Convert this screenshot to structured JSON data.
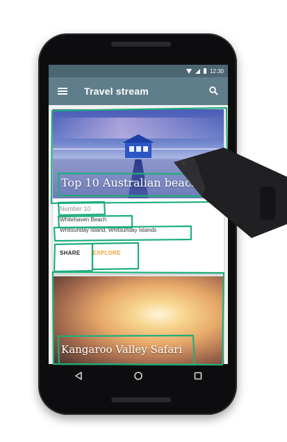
{
  "status_bar": {
    "time": "12:30"
  },
  "app_bar": {
    "title": "Travel stream",
    "menu_icon": "menu-icon",
    "search_icon": "search-icon"
  },
  "cards": [
    {
      "title": "Top 10 Australian beaches",
      "subtitle": "Number 10",
      "line1": "Whitehaven Beach",
      "line2": "Whitsunday Island, Whitsunday Islands",
      "actions": [
        "SHARE",
        "EXPLORE"
      ]
    },
    {
      "title": "Kangaroo Valley Safari"
    }
  ],
  "nav": {
    "back_icon": "back-icon",
    "home_icon": "home-icon",
    "recents_icon": "recents-icon"
  },
  "colors": {
    "app_bar": "#607d8b",
    "status_bar": "#4c6672",
    "explore_accent": "#f0a030",
    "annotation": "#1fae7a"
  }
}
